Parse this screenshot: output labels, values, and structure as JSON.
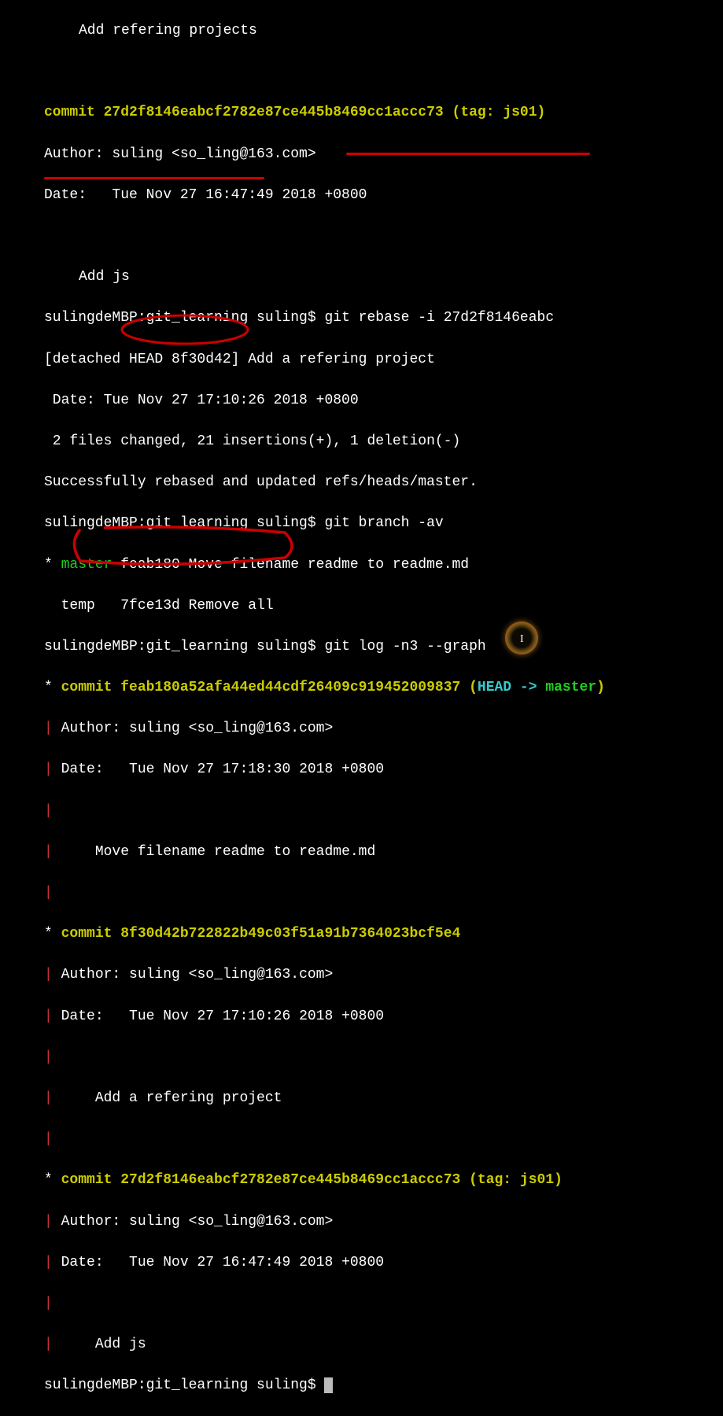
{
  "line_top_msg": "Add refering projects",
  "commit1": {
    "word": "commit",
    "sha": "27d2f8146eabcf2782e87ce445b8469cc1accc73",
    "tag_prefix": "tag: ",
    "tag": "js01",
    "author_line": "Author: suling <so_ling@163.com>",
    "date_line": "Date:   Tue Nov 27 16:47:49 2018 +0800",
    "msg": "Add js"
  },
  "prompt_prefix": "sulingdeMBP:git_learning suling$ ",
  "rebase_cmd": "git rebase -i 27d2f8146eabc",
  "detached_line": "[detached HEAD 8f30d42] Add a refering project",
  "rebase_date": " Date: Tue Nov 27 17:10:26 2018 +0800",
  "rebase_stats": " 2 files changed, 21 insertions(+), 1 deletion(-)",
  "rebase_success": "Successfully rebased and updated refs/heads/master.",
  "branch_cmd": "git branch -av",
  "branch_row1_star": "* ",
  "branch_row1_name": "master",
  "branch_row1_rest": " feab180 Move filename readme to readme.md",
  "branch_row2": "  temp   7fce13d Remove all",
  "log_cmd": "git log -n3 --graph",
  "graph1_star": "* ",
  "graph1_commit": "commit feab180a52afa44ed44cdf26409c919452009837",
  "graph1_open": " (",
  "graph1_head": "HEAD -> ",
  "graph1_master": "master",
  "graph1_close": ")",
  "graph1_author": " Author: suling <so_ling@163.com>",
  "graph1_date": " Date:   Tue Nov 27 17:18:30 2018 +0800",
  "graph1_msg": "     Move filename readme to readme.md",
  "pipe_only": "|",
  "pipe_space": "| ",
  "graph2_commit": "commit 8f30d42b722822b49c03f51a91b7364023bcf5e4",
  "graph2_author": " Author: suling <so_ling@163.com>",
  "graph2_date": " Date:   Tue Nov 27 17:10:26 2018 +0800",
  "graph2_msg": "     Add a refering project",
  "graph3_commit": "commit 27d2f8146eabcf2782e87ce445b8469cc1accc73",
  "graph3_open": " (",
  "graph3_tag_prefix": "tag: ",
  "graph3_tag": "js01",
  "graph3_close": ")",
  "graph3_author": " Author: suling <so_ling@163.com>",
  "graph3_date": " Date:   Tue Nov 27 16:47:49 2018 +0800",
  "graph3_msg": "     Add js"
}
